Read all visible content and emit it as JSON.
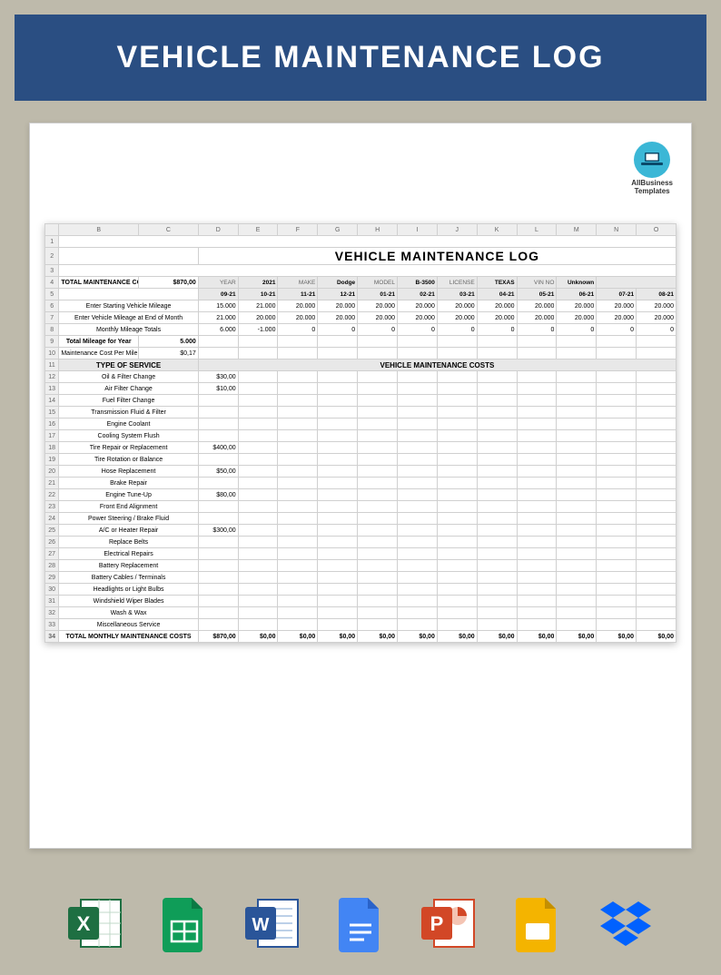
{
  "header_title": "VEHICLE MAINTENANCE LOG",
  "logo_line1": "AllBusiness",
  "logo_line2": "Templates",
  "sheet": {
    "cols": [
      "B",
      "C",
      "D",
      "E",
      "F",
      "G",
      "H",
      "I",
      "J",
      "K",
      "L",
      "M",
      "N",
      "O"
    ],
    "title": "VEHICLE MAINTENANCE LOG",
    "meta": {
      "total_label": "TOTAL MAINTENANCE COSTS",
      "total_value": "$870,00",
      "labels": [
        "YEAR",
        "MAKE",
        "MODEL",
        "LICENSE",
        "VIN NO"
      ],
      "values": [
        "2021",
        "Dodge",
        "B-3500",
        "TEXAS",
        "Unknown"
      ]
    },
    "months": [
      "09-21",
      "10-21",
      "11-21",
      "12-21",
      "01-21",
      "02-21",
      "03-21",
      "04-21",
      "05-21",
      "06-21",
      "07-21",
      "08-21"
    ],
    "r6": {
      "label": "Enter Starting Vehicle Mileage",
      "vals": [
        "15.000",
        "21.000",
        "20.000",
        "20.000",
        "20.000",
        "20.000",
        "20.000",
        "20.000",
        "20.000",
        "20.000",
        "20.000",
        "20.000"
      ]
    },
    "r7": {
      "label": "Enter Vehicle Mileage at End of Month",
      "vals": [
        "21.000",
        "20.000",
        "20.000",
        "20.000",
        "20.000",
        "20.000",
        "20.000",
        "20.000",
        "20.000",
        "20.000",
        "20.000",
        "20.000"
      ]
    },
    "r8": {
      "label": "Monthly Mileage Totals",
      "vals": [
        "6.000",
        "-1.000",
        "0",
        "0",
        "0",
        "0",
        "0",
        "0",
        "0",
        "0",
        "0",
        "0"
      ]
    },
    "r9": {
      "label": "Total Mileage for Year",
      "value": "5.000"
    },
    "r10": {
      "label": "Maintenance Cost Per Mile",
      "value": "$0,17"
    },
    "type_header": "TYPE OF SERVICE",
    "costs_header": "VEHICLE MAINTENANCE COSTS",
    "services": [
      {
        "name": "Oil & Filter Change",
        "val": "$30,00"
      },
      {
        "name": "Air Filter Change",
        "val": "$10,00"
      },
      {
        "name": "Fuel Filter Change",
        "val": ""
      },
      {
        "name": "Transmission Fluid & Filter",
        "val": ""
      },
      {
        "name": "Engine Coolant",
        "val": ""
      },
      {
        "name": "Cooling System Flush",
        "val": ""
      },
      {
        "name": "Tire Repair or Replacement",
        "val": "$400,00"
      },
      {
        "name": "Tire Rotation or Balance",
        "val": ""
      },
      {
        "name": "Hose Replacement",
        "val": "$50,00"
      },
      {
        "name": "Brake Repair",
        "val": ""
      },
      {
        "name": "Engine Tune-Up",
        "val": "$80,00"
      },
      {
        "name": "Front End Alignment",
        "val": ""
      },
      {
        "name": "Power Steering / Brake Fluid",
        "val": ""
      },
      {
        "name": "A/C or Heater Repair",
        "val": "$300,00"
      },
      {
        "name": "Replace Belts",
        "val": ""
      },
      {
        "name": "Electrical Repairs",
        "val": ""
      },
      {
        "name": "Battery Replacement",
        "val": ""
      },
      {
        "name": "Battery Cables / Terminals",
        "val": ""
      },
      {
        "name": "Headlights or Light Bulbs",
        "val": ""
      },
      {
        "name": "Windshield Wiper Blades",
        "val": ""
      },
      {
        "name": "Wash & Wax",
        "val": ""
      },
      {
        "name": "Miscellaneous Service",
        "val": ""
      }
    ],
    "total_row_label": "TOTAL MONTHLY MAINTENANCE COSTS",
    "total_row_vals": [
      "$870,00",
      "$0,00",
      "$0,00",
      "$0,00",
      "$0,00",
      "$0,00",
      "$0,00",
      "$0,00",
      "$0,00",
      "$0,00",
      "$0,00",
      "$0,00"
    ]
  }
}
